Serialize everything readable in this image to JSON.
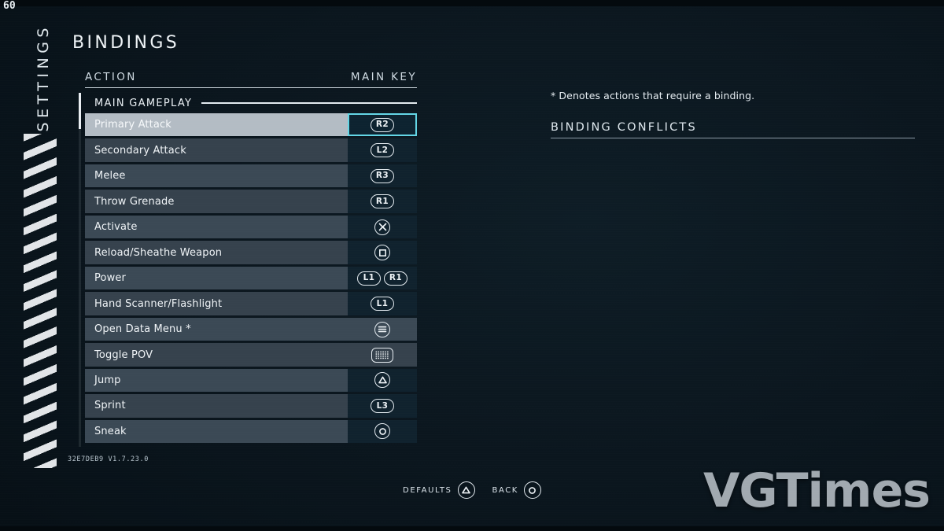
{
  "hud": {
    "fps": "60"
  },
  "sidebar": {
    "vertical_title": "SETTINGS",
    "stripe_decoration": "diagonal-stripes"
  },
  "header": {
    "page_title": "BINDINGS",
    "columns": {
      "action": "ACTION",
      "main_key": "MAIN KEY"
    }
  },
  "list": {
    "section_label": "MAIN GAMEPLAY",
    "rows": [
      {
        "label": "Primary Attack",
        "keys": [
          {
            "type": "text",
            "value": "R2"
          }
        ],
        "selected": true,
        "boxed": true
      },
      {
        "label": "Secondary Attack",
        "keys": [
          {
            "type": "text",
            "value": "L2"
          }
        ],
        "selected": false,
        "boxed": true
      },
      {
        "label": "Melee",
        "keys": [
          {
            "type": "text",
            "value": "R3"
          }
        ],
        "selected": false,
        "boxed": true
      },
      {
        "label": "Throw Grenade",
        "keys": [
          {
            "type": "text",
            "value": "R1"
          }
        ],
        "selected": false,
        "boxed": true
      },
      {
        "label": "Activate",
        "keys": [
          {
            "type": "glyph",
            "value": "cross-icon"
          }
        ],
        "selected": false,
        "boxed": true
      },
      {
        "label": "Reload/Sheathe Weapon",
        "keys": [
          {
            "type": "glyph",
            "value": "square-icon"
          }
        ],
        "selected": false,
        "boxed": true
      },
      {
        "label": "Power",
        "keys": [
          {
            "type": "text",
            "value": "L1"
          },
          {
            "type": "text",
            "value": "R1"
          }
        ],
        "selected": false,
        "boxed": true
      },
      {
        "label": "Hand Scanner/Flashlight",
        "keys": [
          {
            "type": "text",
            "value": "L1"
          }
        ],
        "selected": false,
        "boxed": true
      },
      {
        "label": "Open Data Menu *",
        "keys": [
          {
            "type": "glyph",
            "value": "options-menu-icon"
          }
        ],
        "selected": false,
        "boxed": false
      },
      {
        "label": "Toggle POV",
        "keys": [
          {
            "type": "glyph",
            "value": "touchpad-icon"
          }
        ],
        "selected": false,
        "boxed": false
      },
      {
        "label": "Jump",
        "keys": [
          {
            "type": "glyph",
            "value": "triangle-icon"
          }
        ],
        "selected": false,
        "boxed": true
      },
      {
        "label": "Sprint",
        "keys": [
          {
            "type": "text",
            "value": "L3"
          }
        ],
        "selected": false,
        "boxed": true
      },
      {
        "label": "Sneak",
        "keys": [
          {
            "type": "glyph",
            "value": "circle-icon"
          }
        ],
        "selected": false,
        "boxed": true
      }
    ]
  },
  "right_panel": {
    "denotes_note": "* Denotes actions that require a binding.",
    "conflicts_heading": "BINDING CONFLICTS",
    "conflicts": []
  },
  "footer": {
    "version": "32E7DEB9 V1.7.23.0",
    "prompts": [
      {
        "label": "DEFAULTS",
        "icon": "triangle-icon"
      },
      {
        "label": "BACK",
        "icon": "circle-icon"
      }
    ]
  },
  "watermark": {
    "text": "VGTimes"
  },
  "colors": {
    "background": "#0b161e",
    "row": "#3b4955",
    "row_alt": "#36424d",
    "row_selected": "#b3bcc4",
    "key_cell": "#10222e",
    "accent_cyan": "#63d6e6",
    "text_primary": "#eef3f6"
  }
}
